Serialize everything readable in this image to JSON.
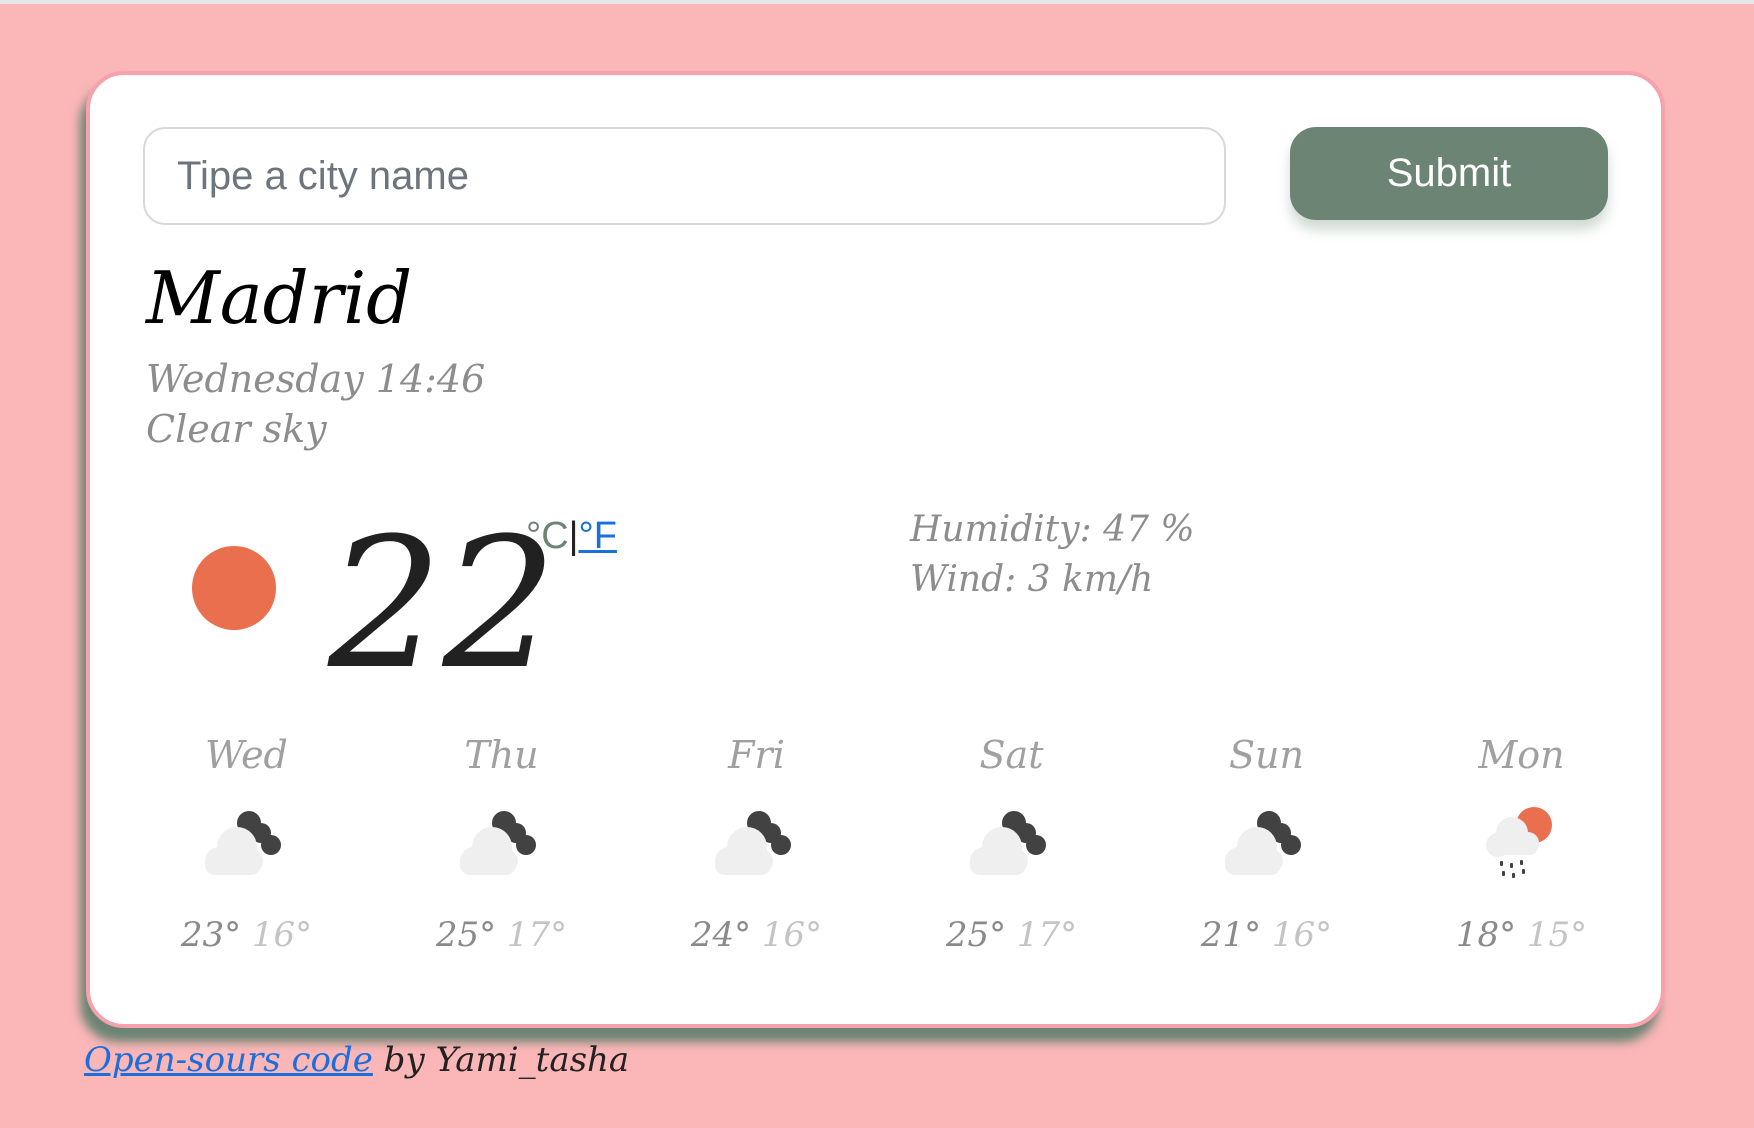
{
  "search": {
    "placeholder": "Tipe a city name",
    "value": "",
    "submit_label": "Submit"
  },
  "current": {
    "city": "Madrid",
    "datetime": "Wednesday 14:46",
    "description": "Clear sky",
    "icon": "sun-icon",
    "temperature": "22",
    "unit_celsius": "°C",
    "unit_separator": "|",
    "unit_fahrenheit": "°F",
    "humidity": "Humidity: 47 %",
    "wind": "Wind: 3 km/h"
  },
  "forecast": [
    {
      "day": "Wed",
      "icon": "night-cloudy-icon",
      "max": "23°",
      "min": "16°"
    },
    {
      "day": "Thu",
      "icon": "night-cloudy-icon",
      "max": "25°",
      "min": "17°"
    },
    {
      "day": "Fri",
      "icon": "night-cloudy-icon",
      "max": "24°",
      "min": "16°"
    },
    {
      "day": "Sat",
      "icon": "night-cloudy-icon",
      "max": "25°",
      "min": "17°"
    },
    {
      "day": "Sun",
      "icon": "night-cloudy-icon",
      "max": "21°",
      "min": "16°"
    },
    {
      "day": "Mon",
      "icon": "rain-sun-icon",
      "max": "18°",
      "min": "15°"
    }
  ],
  "footer": {
    "link_label": "Open-sours code",
    "text": " by Yami_tasha"
  },
  "colors": {
    "background": "#fbb6b7",
    "card_border": "#f7a1ad",
    "accent_green": "#6b8474",
    "sun": "#ea6f4f",
    "link": "#1a6fdc"
  }
}
